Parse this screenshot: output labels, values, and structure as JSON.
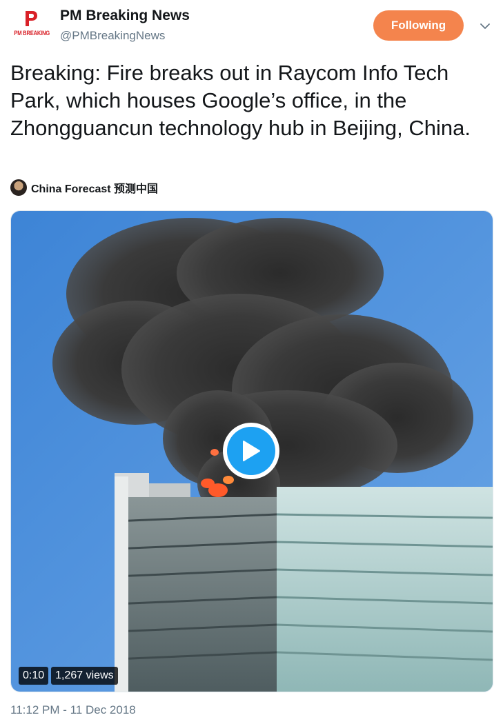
{
  "tweet": {
    "logo": {
      "letter": "P",
      "text": "PM BREAKING"
    },
    "display_name": "PM Breaking News",
    "handle": "@PMBreakingNews",
    "follow_label": "Following",
    "text": "Breaking: Fire breaks out in Raycom Info Tech Park, which houses Google’s office, in the Zhongguancun technology hub in Beijing, China.",
    "attribution": "China Forecast 预测中国",
    "media": {
      "duration": "0:10",
      "views": "1,267 views"
    },
    "timestamp": "11:12 PM - 11 Dec 2018"
  },
  "colors": {
    "follow_button": "#f4844d",
    "play_button": "#1da1f2",
    "logo_red": "#d92128",
    "secondary_text": "#657786"
  },
  "icons": [
    "chevron-down-icon",
    "play-icon",
    "attribution-avatar"
  ]
}
